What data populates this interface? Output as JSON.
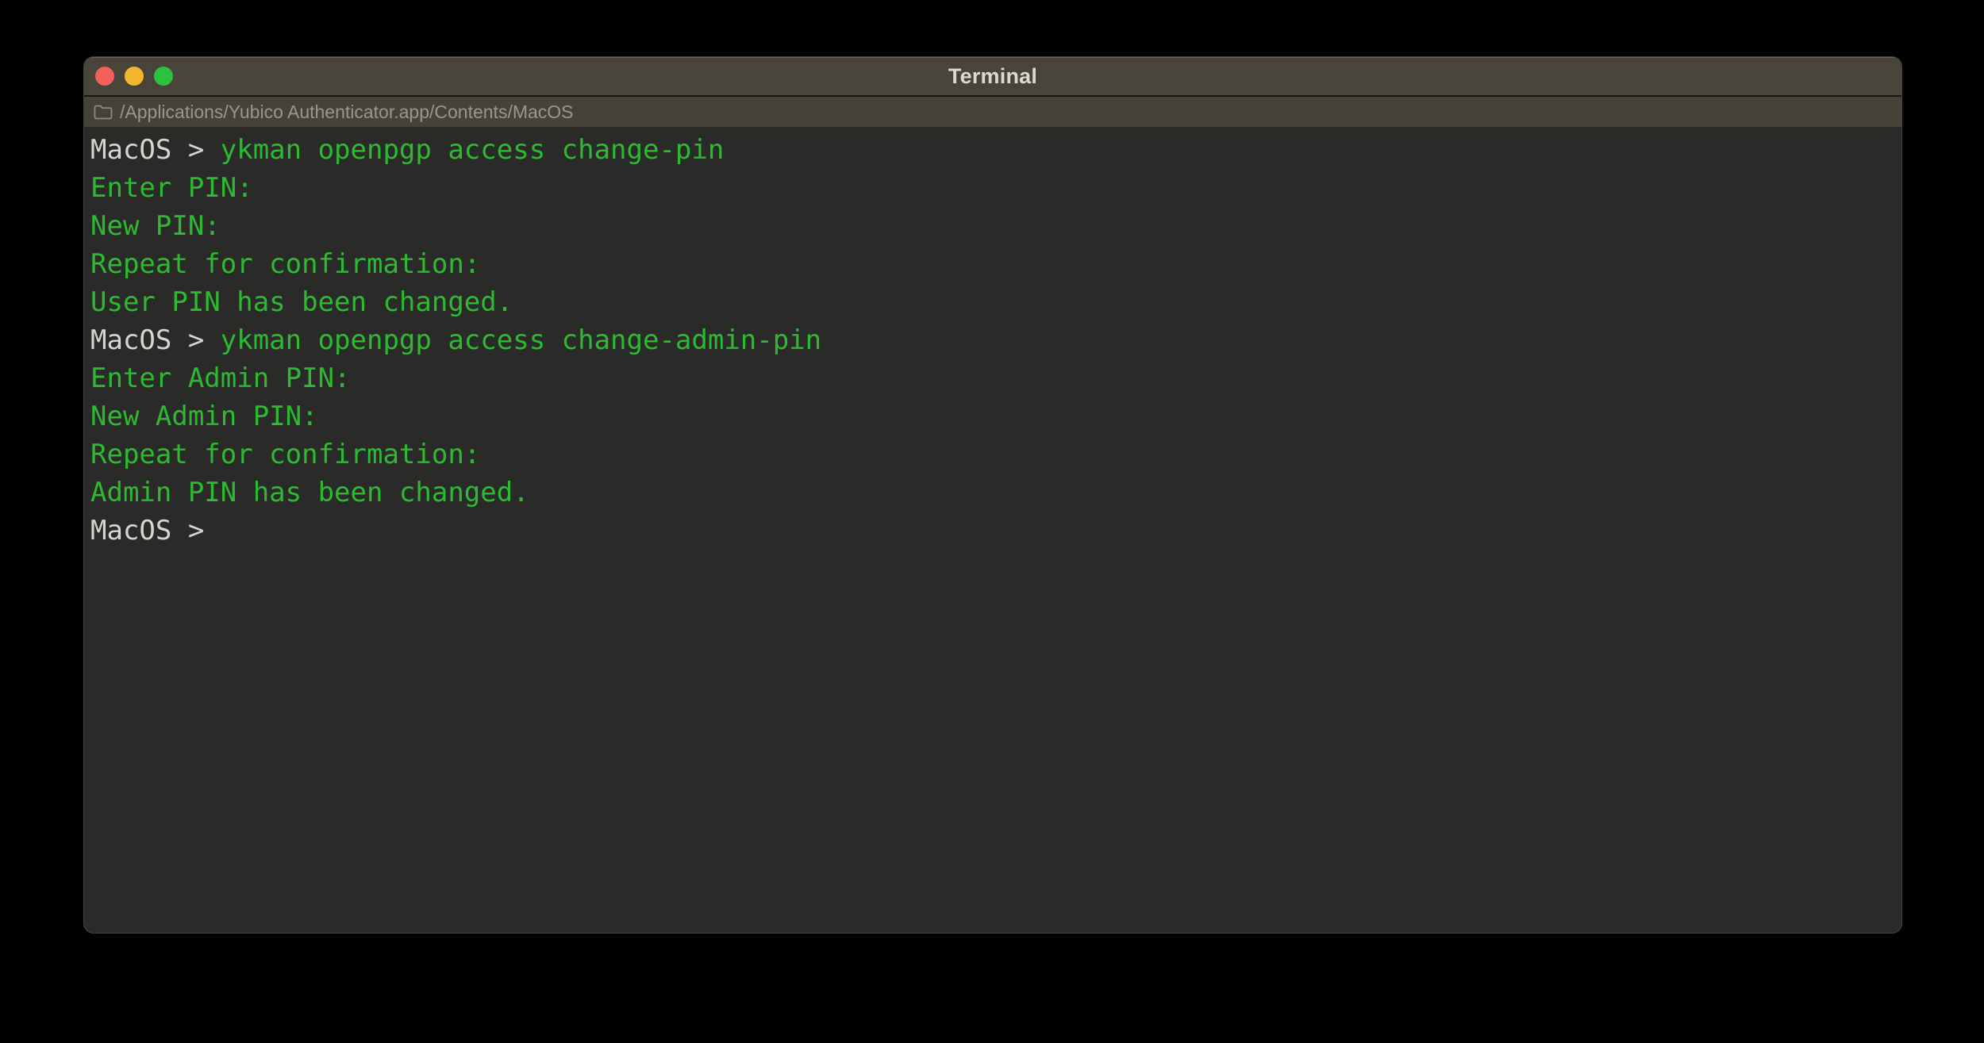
{
  "window": {
    "title": "Terminal",
    "traffic_lights": [
      {
        "name": "close",
        "color": "#f2605a"
      },
      {
        "name": "minimize",
        "color": "#f5b62f"
      },
      {
        "name": "zoom",
        "color": "#2bc33e"
      }
    ]
  },
  "tab_bar": {
    "path": "/Applications/Yubico Authenticator.app/Contents/MacOS"
  },
  "terminal": {
    "lines": [
      [
        {
          "text": "MacOS > ",
          "color": "prompt"
        },
        {
          "text": "ykman openpgp access change-pin",
          "color": "green"
        }
      ],
      [
        {
          "text": "Enter PIN:",
          "color": "green"
        }
      ],
      [
        {
          "text": "New PIN:",
          "color": "green"
        }
      ],
      [
        {
          "text": "Repeat for confirmation:",
          "color": "green"
        }
      ],
      [
        {
          "text": "User PIN has been changed.",
          "color": "green"
        }
      ],
      [
        {
          "text": "MacOS > ",
          "color": "prompt"
        },
        {
          "text": "ykman openpgp access change-admin-pin",
          "color": "green"
        }
      ],
      [
        {
          "text": "Enter Admin PIN:",
          "color": "green"
        }
      ],
      [
        {
          "text": "New Admin PIN:",
          "color": "green"
        }
      ],
      [
        {
          "text": "Repeat for confirmation:",
          "color": "green"
        }
      ],
      [
        {
          "text": "Admin PIN has been changed.",
          "color": "green"
        }
      ],
      [
        {
          "text": "MacOS > ",
          "color": "prompt"
        }
      ]
    ]
  },
  "colors": {
    "prompt": "#d5d5d2",
    "green": "#2eb933",
    "terminal_bg": "#2a2a28",
    "titlebar_bg": "#484439",
    "pathbar_bg": "#46423a",
    "title_text": "#dbd9d5",
    "path_text": "#9a968d"
  }
}
